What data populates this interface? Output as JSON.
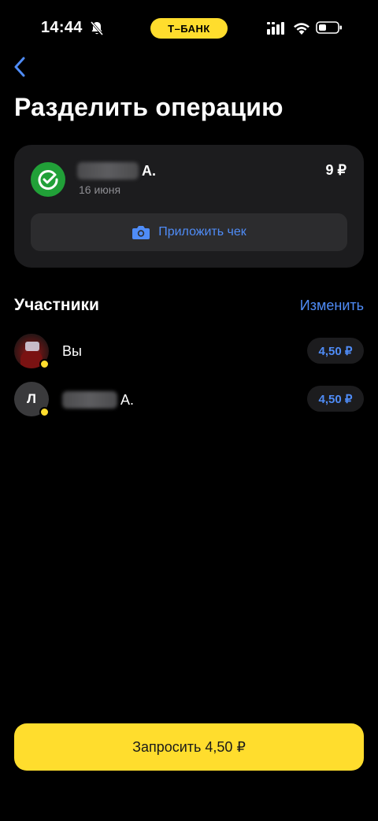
{
  "status_bar": {
    "time": "14:44",
    "bank_label": "Т–БАНК"
  },
  "header": {
    "title": "Разделить операцию"
  },
  "transaction": {
    "merchant_suffix": "А.",
    "date": "16 июня",
    "amount": "9 ₽",
    "attach_receipt_label": "Приложить чек",
    "icon": "checkmark-circle-icon",
    "icon_color": "#21A038"
  },
  "participants": {
    "title": "Участники",
    "edit_label": "Изменить",
    "items": [
      {
        "name": "Вы",
        "amount": "4,50 ₽"
      },
      {
        "initial": "Л",
        "name_suffix": "А.",
        "amount": "4,50 ₽"
      }
    ]
  },
  "footer": {
    "request_label": "Запросить 4,50 ₽"
  },
  "colors": {
    "accent_yellow": "#FFDD2D",
    "link_blue": "#4F8CF7",
    "card_bg": "#1C1C1E",
    "background": "#000000"
  }
}
